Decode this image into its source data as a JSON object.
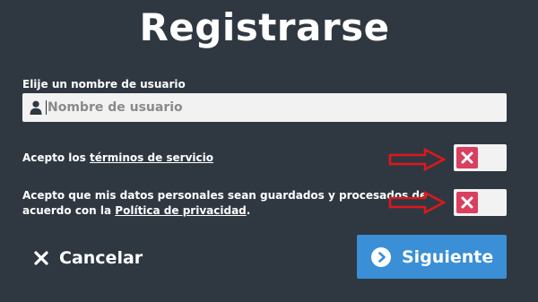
{
  "title": "Registrarse",
  "username": {
    "label": "Elije un nombre de usuario",
    "placeholder": "Nombre de usuario",
    "value": "",
    "icon": "user-icon"
  },
  "terms": {
    "prefix": "Acepto los ",
    "link": "términos de servicio",
    "checked": false
  },
  "privacy": {
    "prefix": "Acepto que mis datos personales sean guardados y procesados de acuerdo con la ",
    "link": "Política de privacidad",
    "suffix": ".",
    "checked": false
  },
  "colors": {
    "background": "#2f3841",
    "toggle_off": "#d93f5f",
    "primary_button": "#3a8fd6",
    "annotation_arrow": "#e0161b"
  },
  "actions": {
    "cancel_label": "Cancelar",
    "cancel_icon": "close-icon",
    "next_label": "Siguiente",
    "next_icon": "chevron-right-circle-icon"
  }
}
